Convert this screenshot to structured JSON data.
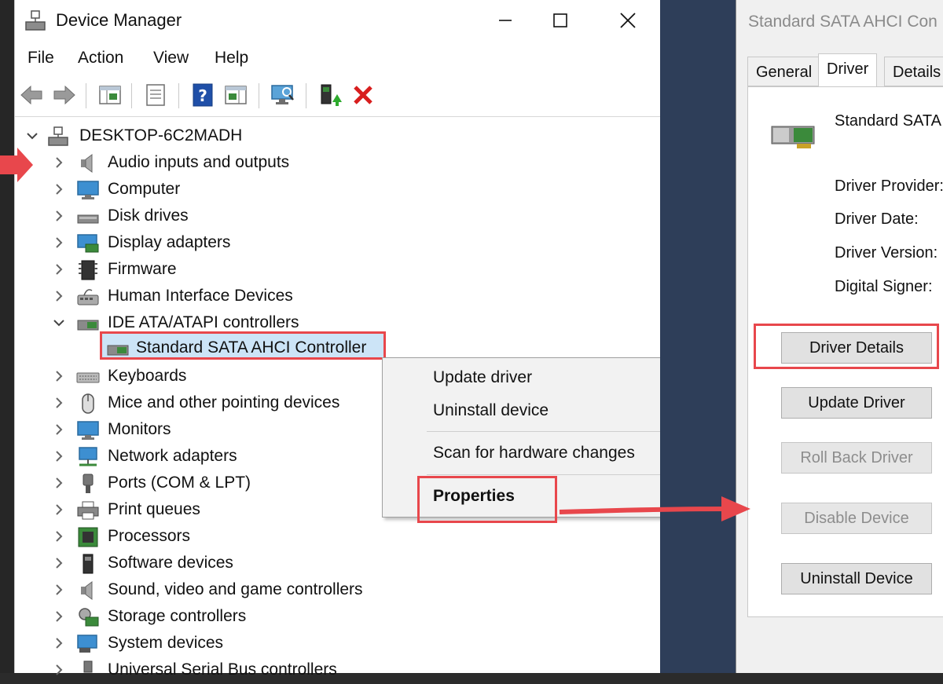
{
  "device_manager": {
    "title": "Device Manager",
    "menu": [
      "File",
      "Action",
      "View",
      "Help"
    ],
    "computer_name": "DESKTOP-6C2MADH",
    "tree": [
      {
        "label": "Audio inputs and outputs",
        "icon": "speaker-icon",
        "expanded": false
      },
      {
        "label": "Computer",
        "icon": "monitor-icon",
        "expanded": false
      },
      {
        "label": "Disk drives",
        "icon": "disk-drive-icon",
        "expanded": false
      },
      {
        "label": "Display adapters",
        "icon": "display-adapter-icon",
        "expanded": false
      },
      {
        "label": "Firmware",
        "icon": "chip-icon",
        "expanded": false
      },
      {
        "label": "Human Interface Devices",
        "icon": "hid-icon",
        "expanded": false
      },
      {
        "label": "IDE ATA/ATAPI controllers",
        "icon": "controller-icon",
        "expanded": true
      },
      {
        "label": "Standard SATA AHCI Controller",
        "icon": "controller-icon",
        "child": true
      },
      {
        "label": "Keyboards",
        "icon": "keyboard-icon",
        "expanded": false
      },
      {
        "label": "Mice and other pointing devices",
        "icon": "mouse-icon",
        "expanded": false
      },
      {
        "label": "Monitors",
        "icon": "monitor-icon",
        "expanded": false
      },
      {
        "label": "Network adapters",
        "icon": "network-icon",
        "expanded": false
      },
      {
        "label": "Ports (COM & LPT)",
        "icon": "port-icon",
        "expanded": false
      },
      {
        "label": "Print queues",
        "icon": "printer-icon",
        "expanded": false
      },
      {
        "label": "Processors",
        "icon": "processor-icon",
        "expanded": false
      },
      {
        "label": "Software devices",
        "icon": "software-device-icon",
        "expanded": false
      },
      {
        "label": "Sound, video and game controllers",
        "icon": "speaker-icon",
        "expanded": false
      },
      {
        "label": "Storage controllers",
        "icon": "storage-icon",
        "expanded": false
      },
      {
        "label": "System devices",
        "icon": "system-icon",
        "expanded": false
      },
      {
        "label": "Universal Serial Bus controllers",
        "icon": "usb-icon",
        "expanded": false
      }
    ],
    "context_menu": {
      "update_driver": "Update driver",
      "uninstall_device": "Uninstall device",
      "scan": "Scan for hardware changes",
      "properties": "Properties"
    }
  },
  "properties_dialog": {
    "title": "Standard SATA AHCI Con",
    "tabs": [
      "General",
      "Driver",
      "Details"
    ],
    "active_tab": "Driver",
    "device_name": "Standard SATA",
    "fields": {
      "provider": "Driver Provider:",
      "date": "Driver Date:",
      "version": "Driver Version:",
      "signer": "Digital Signer:"
    },
    "buttons": {
      "driver_details": "Driver Details",
      "update_driver": "Update Driver",
      "roll_back": "Roll Back Driver",
      "disable": "Disable Device",
      "uninstall": "Uninstall Device"
    }
  },
  "colors": {
    "highlight": "#e8474c",
    "selection": "#cce4f7"
  }
}
